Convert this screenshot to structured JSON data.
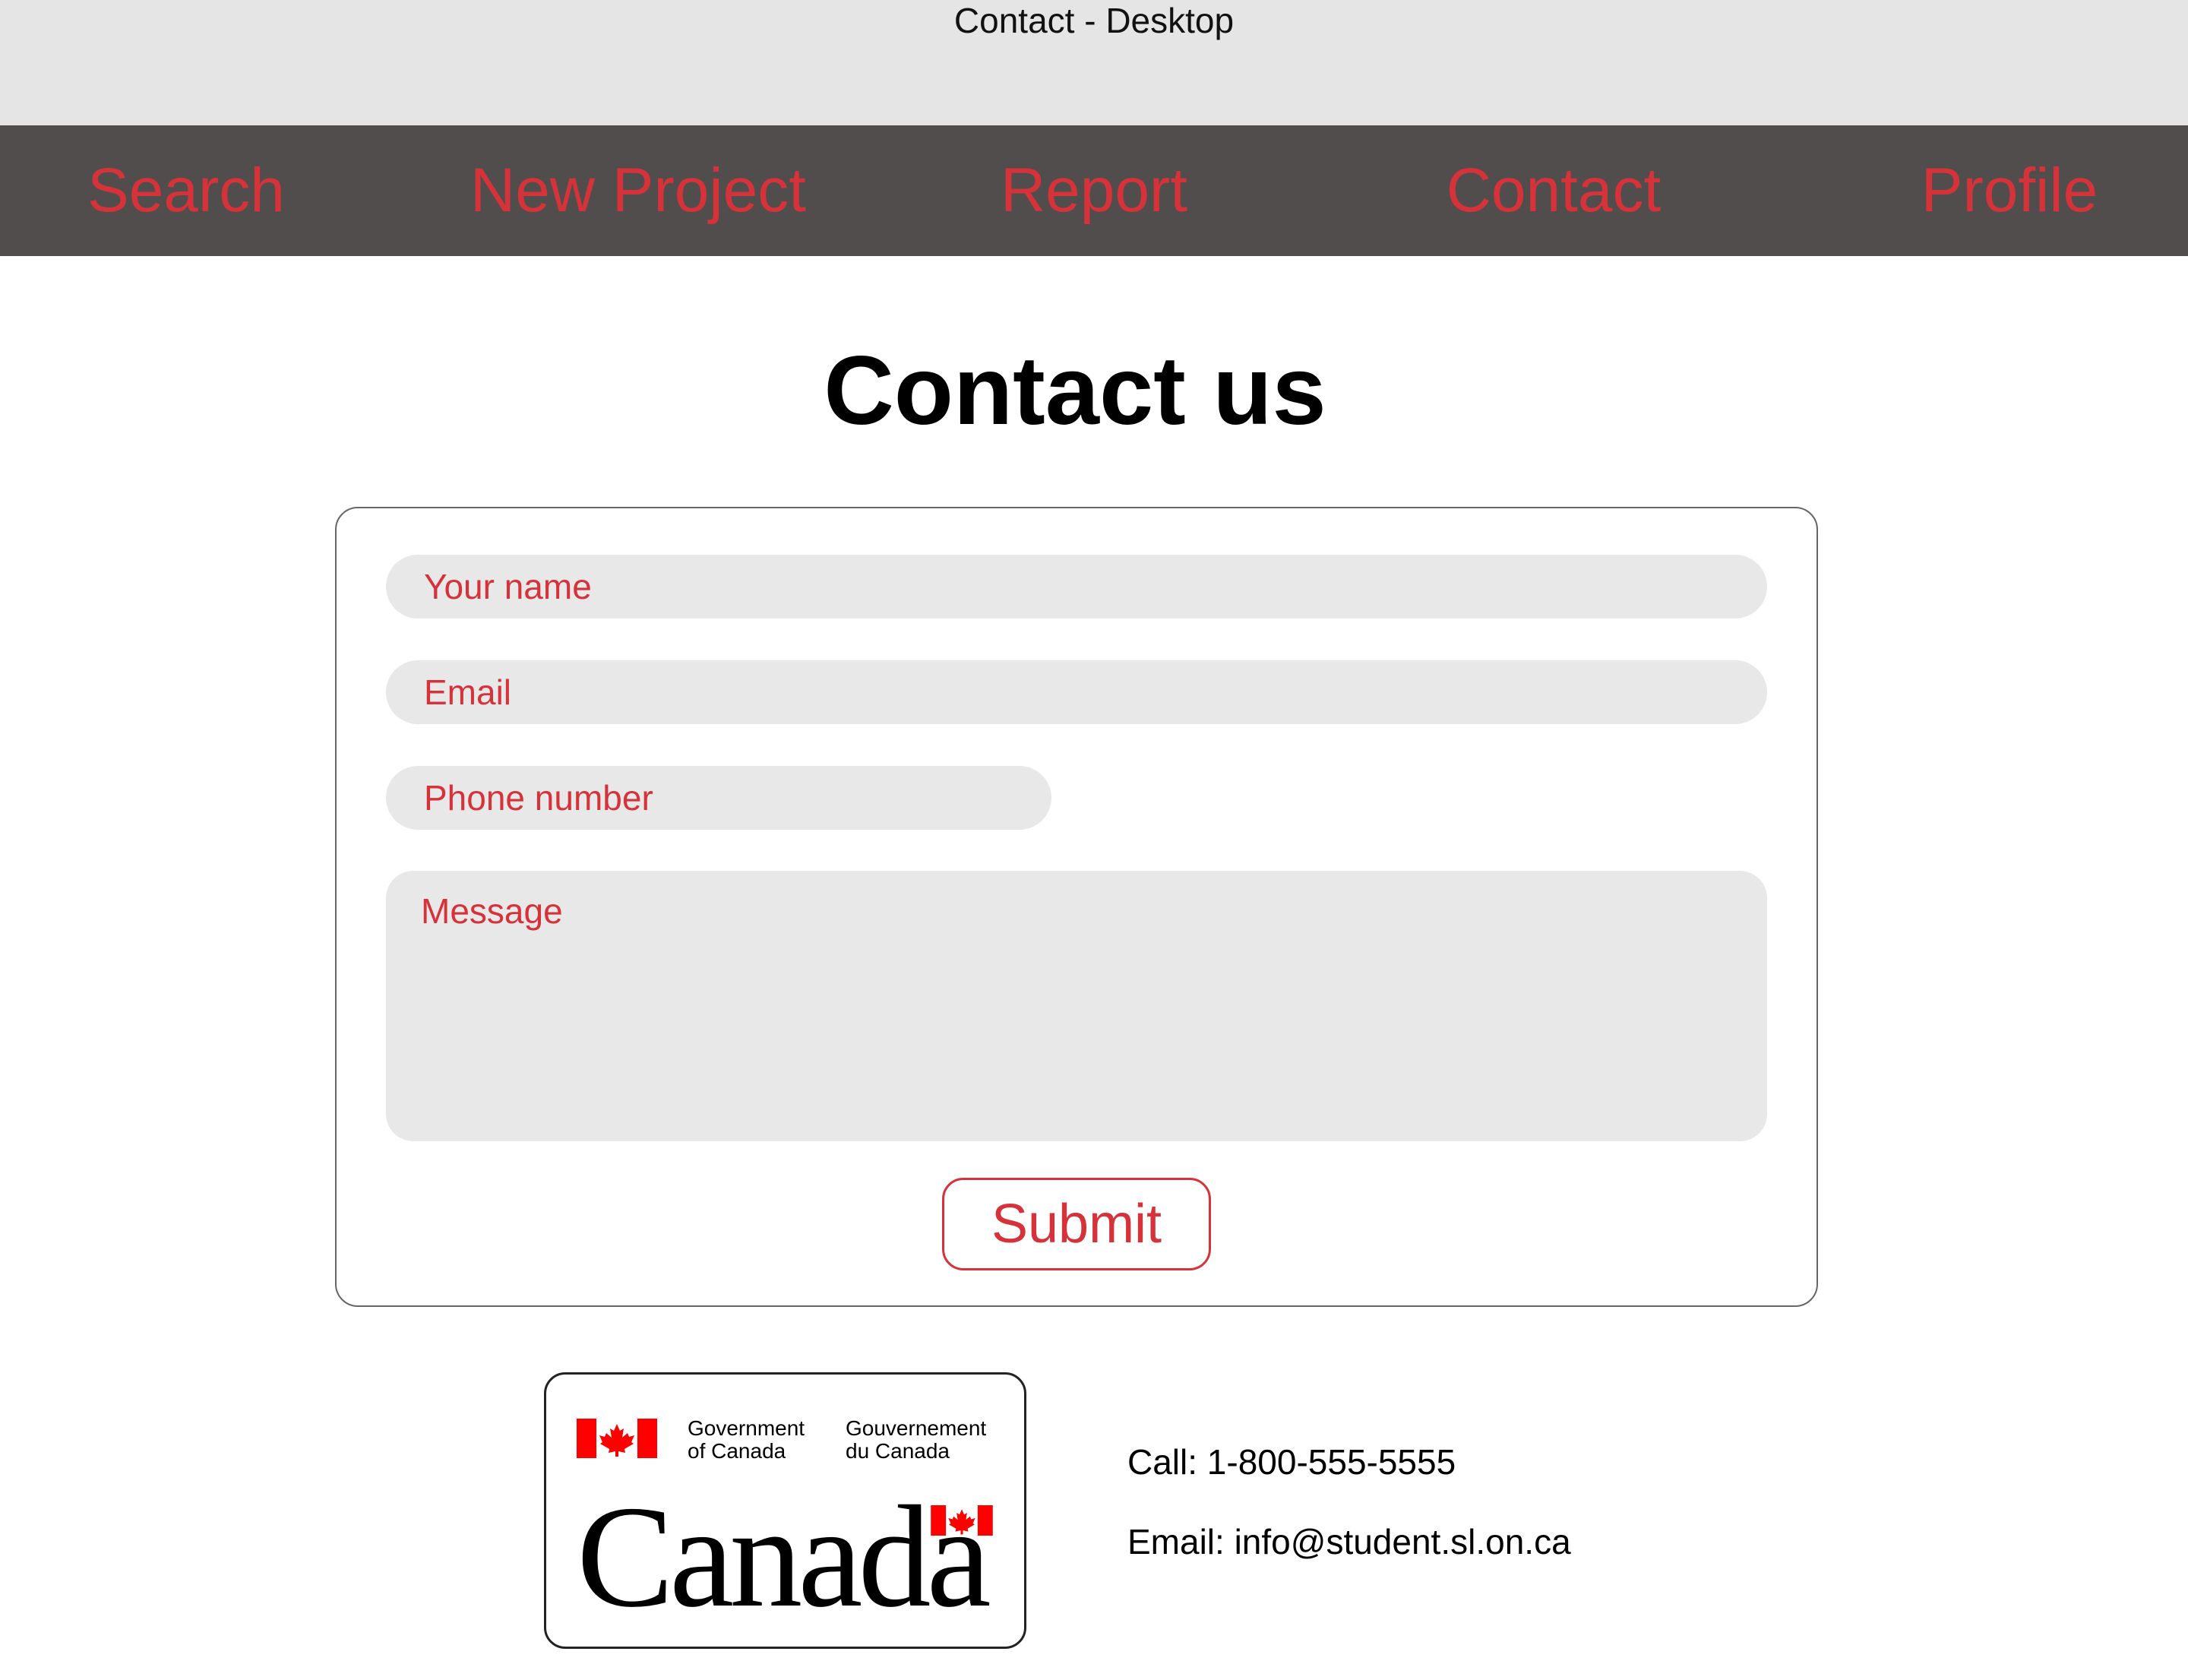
{
  "frame": {
    "title": "Contact - Desktop"
  },
  "nav": {
    "items": [
      {
        "label": "Search"
      },
      {
        "label": "New Project"
      },
      {
        "label": "Report"
      },
      {
        "label": "Contact"
      },
      {
        "label": "Profile"
      }
    ]
  },
  "main": {
    "title": "Contact us"
  },
  "form": {
    "name_placeholder": "Your name",
    "email_placeholder": "Email",
    "phone_placeholder": "Phone number",
    "message_placeholder": "Message",
    "submit_label": "Submit"
  },
  "logo": {
    "gov_en": "Government\nof Canada",
    "gov_fr": "Gouvernement\ndu Canada",
    "wordmark": "Canada"
  },
  "contact": {
    "phone": "Call: 1-800-555-5555",
    "email": "Email: info@student.sl.on.ca"
  },
  "colors": {
    "accent": "#d6323a",
    "nav_bg": "#514d4c",
    "header_bg": "#e5e5e5",
    "field_bg": "#e8e8e8"
  }
}
